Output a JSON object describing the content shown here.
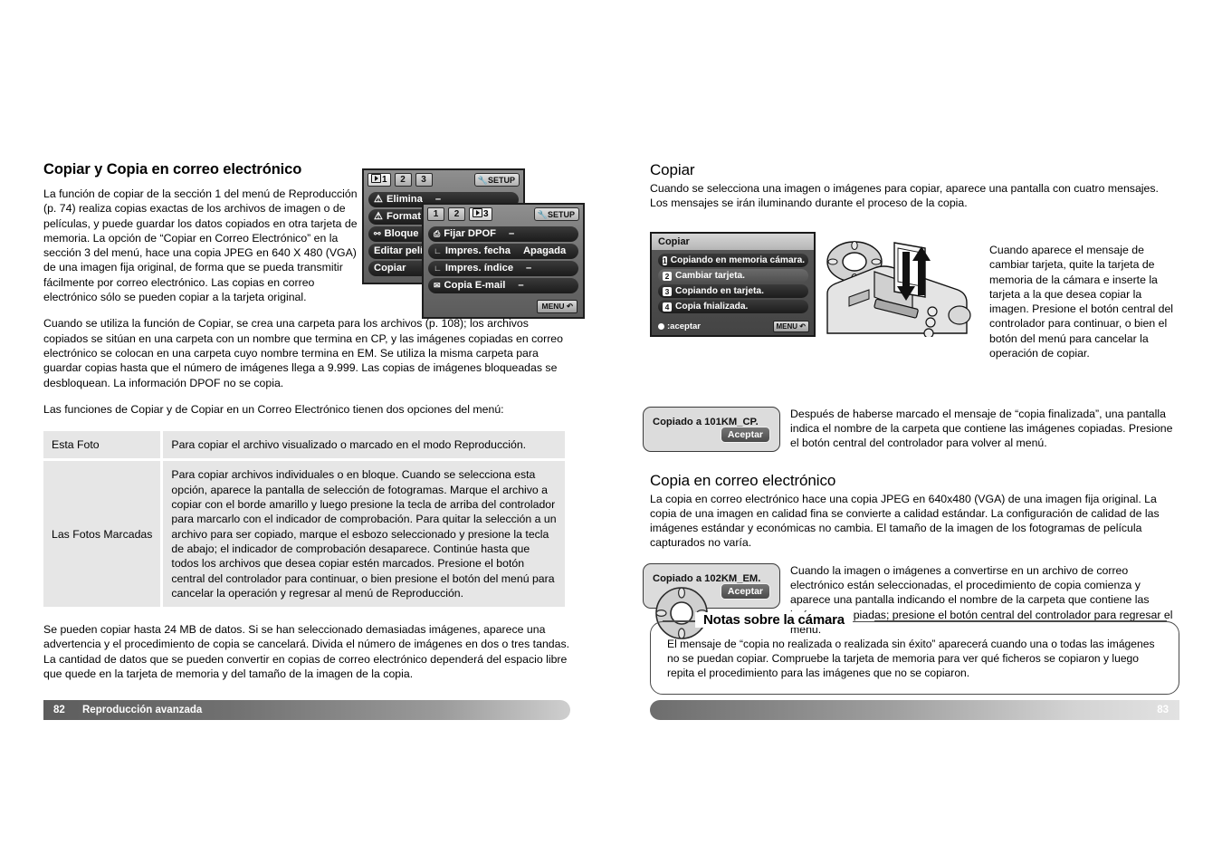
{
  "left_page": {
    "title": "Copiar y Copia en correo electrónico",
    "intro": "La función de copiar de la sección 1 del menú de Reproducción (p. 74) realiza copias exactas de los archivos de imagen o de películas, y puede guardar los datos copiados en otra tarjeta de memoria.  La opción de “Copiar en Correo Electrónico” en la sección 3 del menú, hace una copia JPEG en 640 X 480 (VGA) de una imagen fija original, de forma que se pueda transmitir fácilmente por correo electrónico.  Las copias en correo electrónico sólo se pueden copiar a la tarjeta original.",
    "para2": "Cuando se utiliza la función de Copiar, se crea una carpeta para los archivos (p. 108); los archivos copiados se sitúan en una carpeta con un nombre que termina en CP, y las imágenes copiadas en correo electrónico se colocan en una carpeta cuyo nombre termina en EM.  Se utiliza la misma carpeta para guardar copias hasta que el número de imágenes llega a 9.999.  Las copias de imágenes bloqueadas se desbloquean.  La información DPOF no se copia.",
    "para3": "Las funciones de Copiar y de Copiar en un Correo Electrónico tienen dos opciones del menú:",
    "table": {
      "rows": [
        {
          "name": "Esta Foto",
          "desc": "Para copiar el archivo visualizado o marcado en el modo Reproducción."
        },
        {
          "name": "Las Fotos Marcadas",
          "desc": "Para copiar archivos individuales o en bloque.  Cuando se selecciona esta opción, aparece la pantalla de selección de fotogramas.  Marque el archivo a copiar con el borde amarillo y luego presione la tecla de arriba del controlador para marcarlo con el indicador de comprobación.  Para quitar la selección a un archivo para ser copiado, marque el esbozo seleccionado y presione la tecla de abajo; el indicador de comprobación desaparece.  Continúe hasta que todos los archivos que desea copiar estén marcados.  Presione el botón central del controlador para continuar, o bien presione el botón del menú para cancelar la operación y regresar al menú de Reproducción."
        }
      ]
    },
    "para4": "Se pueden copiar hasta 24 MB de datos.  Si se han seleccionado demasiadas imágenes, aparece una advertencia y el procedimiento de copia se cancelará.  Divida el número de imágenes en dos o tres tandas.  La cantidad de datos que se pueden convertir en copias de correo electrónico dependerá del espacio libre que quede en la tarjeta de memoria y del tamaño de la imagen de la copia."
  },
  "menu_back": {
    "tabs": [
      {
        "label": "1",
        "active": true,
        "icon": "playback-icon"
      },
      {
        "label": "2",
        "active": false
      },
      {
        "label": "3",
        "active": false
      }
    ],
    "setup_label": "SETUP",
    "rows": [
      {
        "icon": "delete-icon",
        "label": "Elimina",
        "value": "–"
      },
      {
        "icon": "format-icon",
        "label": "Format",
        "value": ""
      },
      {
        "icon": "lock-key-icon",
        "label": "Bloque",
        "value": ""
      },
      {
        "icon": "",
        "label": "Editar pelí",
        "value": ""
      },
      {
        "icon": "",
        "label": "Copiar",
        "value": ""
      }
    ]
  },
  "menu_front": {
    "tabs": [
      {
        "label": "1",
        "active": false
      },
      {
        "label": "2",
        "active": false
      },
      {
        "label": "3",
        "active": true,
        "icon": "playback-icon"
      }
    ],
    "setup_label": "SETUP",
    "menu_button_label": "MENU",
    "rows": [
      {
        "icon": "print-dpof-icon",
        "label": "Fijar DPOF",
        "value": "–"
      },
      {
        "icon": "sub-branch-icon",
        "label": "Impres. fecha",
        "value": "Apagada"
      },
      {
        "icon": "sub-branch-icon",
        "label": "Impres. índice",
        "value": "–"
      },
      {
        "icon": "envelope-icon",
        "label": "Copia E-mail",
        "value": "–"
      }
    ]
  },
  "right_page": {
    "copiar": {
      "title": "Copiar",
      "para": "Cuando se selecciona una imagen o imágenes para copiar, aparece una pantalla con cuatro mensajes.  Los mensajes se irán iluminando durante el proceso de la copia.",
      "side_text": "Cuando aparece el mensaje de cambiar tarjeta, quite la tarjeta de memoria de la cámara e inserte la tarjeta a la que desea copiar la imagen.  Presione el botón central del controlador para continuar, o bien el botón del menú para cancelar la operación de copiar.",
      "screen": {
        "title": "Copiar",
        "items": [
          {
            "num": "1",
            "text": "Copiando en memoria cámara."
          },
          {
            "num": "2",
            "text": "Cambiar tarjeta."
          },
          {
            "num": "3",
            "text": "Copiando en tarjeta."
          },
          {
            "num": "4",
            "text": "Copia fnializada."
          }
        ],
        "accept_label": ":aceptar",
        "menu_button_label": "MENU"
      }
    },
    "msg1": {
      "text": "Copiado a 101KM_CP.",
      "button": "Aceptar",
      "side_text": "Después de haberse marcado el mensaje de “copia finalizada”, una pantalla indica el nombre de la carpeta que contiene las imágenes copiadas.  Presione el botón central del controlador para volver al menú."
    },
    "email": {
      "title": "Copia en correo electrónico",
      "para": "La copia en correo electrónico hace una copia JPEG en 640x480 (VGA) de una imagen fija original.  La copia de una imagen en calidad fina se convierte a calidad estándar.  La configuración de calidad de las imágenes estándar y económicas no cambia.  El tamaño de la imagen de los fotogramas de película capturados no varía."
    },
    "msg2": {
      "text": "Copiado a 102KM_EM.",
      "button": "Aceptar",
      "side_text": "Cuando la imagen o imágenes a convertirse en un archivo de correo electrónico están seleccionadas, el procedimiento de copia comienza y aparece una pantalla indicando el nombre de la carpeta que contiene las imágenes copiadas; presione el botón central del controlador para regresar el menú."
    },
    "notes": {
      "heading": "Notas sobre la cámara",
      "body": "El mensaje de “copia no realizada o realizada sin éxito” aparecerá cuando una o todas las imágenes no se puedan copiar.  Compruebe la tarjeta de memoria para ver qué ficheros se copiaron y luego repita el procedimiento para las imágenes que no se copiaron."
    }
  },
  "footers": {
    "left_page_number": "82",
    "left_chapter": "Reproducción avanzada",
    "right_page_number": "83"
  }
}
